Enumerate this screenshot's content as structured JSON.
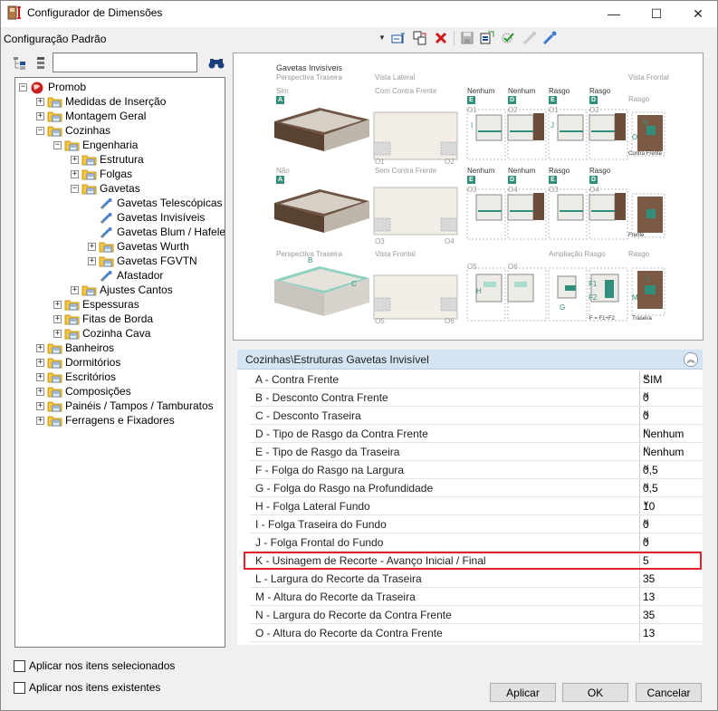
{
  "window": {
    "title": "Configurador de Dimensões",
    "minimize": "—",
    "maximize": "☐",
    "close": "✕"
  },
  "toolbar": {
    "config_label": "Configuração Padrão",
    "dropdown_arrow": "▼"
  },
  "tree": {
    "search_value": "",
    "items": [
      {
        "label": "Promob",
        "expander": "−"
      },
      {
        "label": "Medidas de Inserção",
        "expander": "+"
      },
      {
        "label": "Montagem Geral",
        "expander": "+"
      },
      {
        "label": "Cozinhas",
        "expander": "−"
      },
      {
        "label": "Engenharia",
        "expander": "−"
      },
      {
        "label": "Estrutura",
        "expander": "+"
      },
      {
        "label": "Folgas",
        "expander": "+"
      },
      {
        "label": "Gavetas",
        "expander": "−"
      },
      {
        "label": "Gavetas Telescópicas",
        "expander": ""
      },
      {
        "label": "Gavetas Invisíveis",
        "expander": ""
      },
      {
        "label": "Gavetas Blum / Hafele",
        "expander": ""
      },
      {
        "label": "Gavetas Wurth",
        "expander": "+"
      },
      {
        "label": "Gavetas FGVTN",
        "expander": "+"
      },
      {
        "label": "Afastador",
        "expander": ""
      },
      {
        "label": "Ajustes Cantos",
        "expander": "+"
      },
      {
        "label": "Espessuras",
        "expander": "+"
      },
      {
        "label": "Fitas de Borda",
        "expander": "+"
      },
      {
        "label": "Cozinha Cava",
        "expander": "+"
      },
      {
        "label": "Banheiros",
        "expander": "+"
      },
      {
        "label": "Dormitórios",
        "expander": "+"
      },
      {
        "label": "Escritórios",
        "expander": "+"
      },
      {
        "label": "Composições",
        "expander": "+"
      },
      {
        "label": "Painéis / Tampos / Tamburatos",
        "expander": "+"
      },
      {
        "label": "Ferragens e Fixadores",
        "expander": "+"
      }
    ]
  },
  "preview": {
    "title": "Gavetas Invisíveis",
    "persp_traseira": "Perspectiva Traseira",
    "vista_lateral": "Vista Lateral",
    "vista_frontal_top": "Vista Frontal",
    "sim": "Sim",
    "nao": "Não",
    "com_contra_frente": "Com Contra Frente",
    "sem_contra_frente": "Sem Contra Frente",
    "nenhum": "Nenhum",
    "rasgo": "Rasgo",
    "persp_traseira2": "Perspectiva Traseira",
    "vista_frontal2": "Vista Frontal",
    "ampliacao_rasgo": "Ampliação Rasgo",
    "rasgo_label": "Rasgo",
    "contra_frente": "Contra Frente",
    "frente": "Frente",
    "traseira": "Traseira",
    "formula": "F = F1+F2",
    "o1": "O1",
    "o2": "O2",
    "o3": "O3",
    "o4": "O4",
    "o5": "O5",
    "o6": "O6",
    "badge_a": "A",
    "badge_d": "D",
    "badge_e": "E",
    "l_b": "B",
    "l_c": "C",
    "l_f1": "F1",
    "l_f2": "F2",
    "l_g": "G",
    "l_h": "H",
    "l_i": "I",
    "l_j": "J",
    "l_l": "L",
    "l_m": "M",
    "l_n": "N",
    "l_o": "O"
  },
  "properties": {
    "section_title": "Cozinhas\\Estruturas Gavetas Invisível",
    "collapse_glyph": "︽",
    "rows": [
      {
        "name": "A - Contra Frente",
        "value": "SIM",
        "dropdown": "∨"
      },
      {
        "name": "B - Desconto Contra Frente",
        "value": "0",
        "dropdown": "∨"
      },
      {
        "name": "C - Desconto Traseira",
        "value": "0",
        "dropdown": "∨"
      },
      {
        "name": "D - Tipo de Rasgo da Contra Frente",
        "value": "Nenhum",
        "dropdown": "∨"
      },
      {
        "name": "E - Tipo de Rasgo da Traseira",
        "value": "Nenhum",
        "dropdown": "∨"
      },
      {
        "name": "F - Folga do Rasgo na Largura",
        "value": "0,5",
        "dropdown": "∨"
      },
      {
        "name": "G - Folga do Rasgo na Profundidade",
        "value": "0,5",
        "dropdown": "∨"
      },
      {
        "name": "H - Folga Lateral Fundo",
        "value": "10",
        "dropdown": "∨"
      },
      {
        "name": "I - Folga Traseira do Fundo",
        "value": "0",
        "dropdown": "∨"
      },
      {
        "name": "J - Folga Frontal do Fundo",
        "value": "0",
        "dropdown": "∨"
      },
      {
        "name": "K - Usinagem de Recorte - Avanço Inicial / Final",
        "value": "5",
        "dropdown": ""
      },
      {
        "name": "L - Largura do Recorte da Traseira",
        "value": "35",
        "dropdown": ""
      },
      {
        "name": "M - Altura do Recorte da Traseira",
        "value": "13",
        "dropdown": ""
      },
      {
        "name": "N - Largura do Recorte da Contra Frente",
        "value": "35",
        "dropdown": ""
      },
      {
        "name": "O - Altura do Recorte da Contra Frente",
        "value": "13",
        "dropdown": ""
      }
    ]
  },
  "options": {
    "apply_selected": "Aplicar nos itens selecionados",
    "apply_existing": "Aplicar nos itens existentes"
  },
  "buttons": {
    "apply": "Aplicar",
    "ok": "OK",
    "cancel": "Cancelar"
  },
  "colors": {
    "accent_teal": "#2f8f7a",
    "highlight_red": "#e0202a",
    "header_blue": "#d5e4f3"
  }
}
